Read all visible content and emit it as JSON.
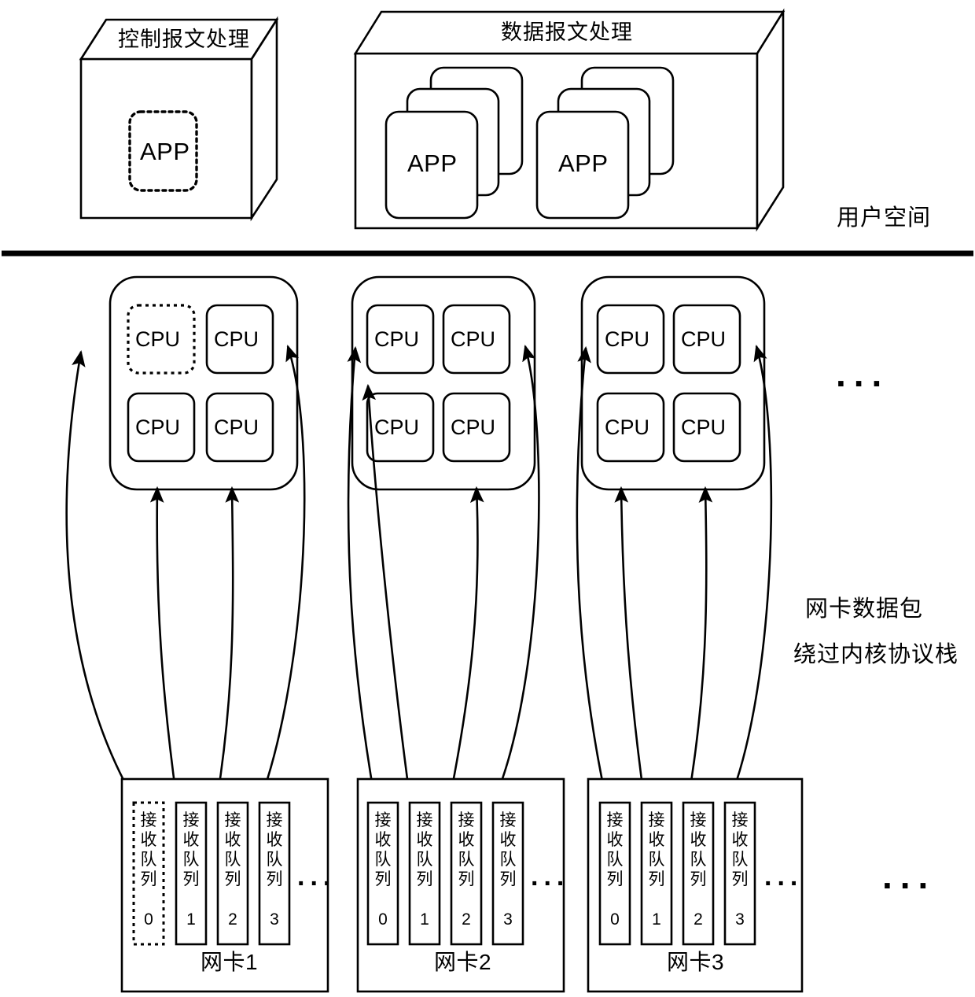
{
  "diagram": {
    "user_space_label": "用户空间",
    "side_note_line1": "网卡数据包",
    "side_note_line2": "绕过内核协议栈",
    "ellipsis": "...",
    "colors": {
      "stroke": "#000000",
      "background": "#ffffff"
    }
  },
  "upper": {
    "boxes": [
      {
        "title": "控制报文处理",
        "apps": [
          {
            "label": "APP",
            "dashed": true,
            "stacked": false
          }
        ]
      },
      {
        "title": "数据报文处理",
        "apps": [
          {
            "label": "APP",
            "dashed": false,
            "stacked": true
          },
          {
            "label": "APP",
            "dashed": false,
            "stacked": true
          }
        ]
      }
    ]
  },
  "cpu_clusters": [
    {
      "name": "cluster-1",
      "cpus": [
        {
          "label": "CPU",
          "dashed": true
        },
        {
          "label": "CPU",
          "dashed": false
        },
        {
          "label": "CPU",
          "dashed": false
        },
        {
          "label": "CPU",
          "dashed": false
        }
      ]
    },
    {
      "name": "cluster-2",
      "cpus": [
        {
          "label": "CPU",
          "dashed": false
        },
        {
          "label": "CPU",
          "dashed": false
        },
        {
          "label": "CPU",
          "dashed": false
        },
        {
          "label": "CPU",
          "dashed": false
        }
      ]
    },
    {
      "name": "cluster-3",
      "cpus": [
        {
          "label": "CPU",
          "dashed": false
        },
        {
          "label": "CPU",
          "dashed": false
        },
        {
          "label": "CPU",
          "dashed": false
        },
        {
          "label": "CPU",
          "dashed": false
        }
      ]
    }
  ],
  "nics": [
    {
      "title": "网卡1",
      "queue_label": "接收队列",
      "ellipsis": "...",
      "queues": [
        {
          "text": "接收队列",
          "index": "0",
          "dashed": true
        },
        {
          "text": "接收队列",
          "index": "1",
          "dashed": false
        },
        {
          "text": "接收队列",
          "index": "2",
          "dashed": false
        },
        {
          "text": "接收队列",
          "index": "3",
          "dashed": false
        }
      ]
    },
    {
      "title": "网卡2",
      "queue_label": "接收队列",
      "ellipsis": "...",
      "queues": [
        {
          "text": "接收队列",
          "index": "0",
          "dashed": false
        },
        {
          "text": "接收队列",
          "index": "1",
          "dashed": false
        },
        {
          "text": "接收队列",
          "index": "2",
          "dashed": false
        },
        {
          "text": "接收队列",
          "index": "3",
          "dashed": false
        }
      ]
    },
    {
      "title": "网卡3",
      "queue_label": "接收队列",
      "ellipsis": "...",
      "queues": [
        {
          "text": "接收队列",
          "index": "0",
          "dashed": false
        },
        {
          "text": "接收队列",
          "index": "1",
          "dashed": false
        },
        {
          "text": "接收队列",
          "index": "2",
          "dashed": false
        },
        {
          "text": "接收队列",
          "index": "3",
          "dashed": false
        }
      ]
    }
  ]
}
